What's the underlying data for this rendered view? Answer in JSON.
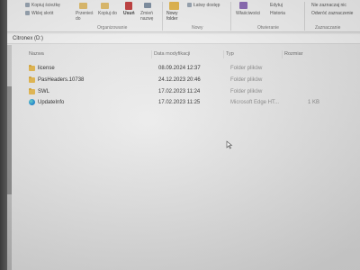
{
  "ribbon": {
    "copy_path": "Kopiuj ścieżkę",
    "paste_shortcut": "Wklej skrót",
    "move_to": "Przenieś do",
    "copy_to": "Kopiuj do",
    "delete": "Usuń",
    "rename": "Zmień nazwę",
    "new_folder": "Nowy folder",
    "easy_access": "Łatwy dostęp",
    "properties": "Właściwości",
    "edit": "Edytuj",
    "history": "Historia",
    "none_selected": "Nie zaznaczaj nic",
    "invert_selection": "Odwróć zaznaczenie",
    "group_organize": "Organizowanie",
    "group_new": "Nowy",
    "group_open": "Otwieranie",
    "group_select": "Zaznaczanie"
  },
  "address": {
    "path": "Citronex (D:)"
  },
  "columns": {
    "name": "Nazwa",
    "date": "Data modyfikacji",
    "type": "Typ",
    "size": "Rozmiar"
  },
  "files": [
    {
      "name": "license",
      "date": "08.09.2024 12:37",
      "type": "Folder plików",
      "size": "",
      "icon": "folder-icon"
    },
    {
      "name": "PasHeaders.10738",
      "date": "24.12.2023 20:46",
      "type": "Folder plików",
      "size": "",
      "icon": "folder-icon"
    },
    {
      "name": "SWL",
      "date": "17.02.2023 11:24",
      "type": "Folder plików",
      "size": "",
      "icon": "folder-icon"
    },
    {
      "name": "UpdateInfo",
      "date": "17.02.2023 11:25",
      "type": "Microsoft Edge HT...",
      "size": "1 KB",
      "icon": "edge-icon"
    }
  ],
  "colors": {
    "folder": "#e9b949",
    "edge": "#1b8fd6"
  }
}
